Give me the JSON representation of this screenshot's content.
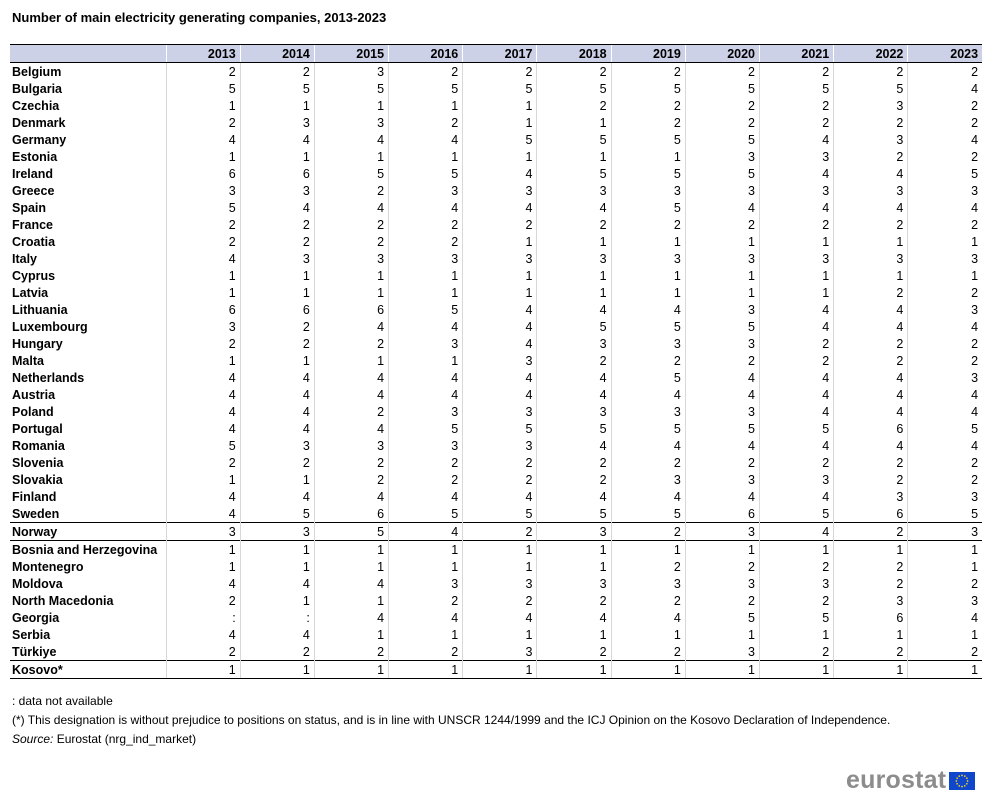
{
  "title": "Number of main electricity generating companies, 2013-2023",
  "chart_data": {
    "type": "table",
    "title": "Number of main electricity generating companies, 2013-2023",
    "columns": [
      "2013",
      "2014",
      "2015",
      "2016",
      "2017",
      "2018",
      "2019",
      "2020",
      "2021",
      "2022",
      "2023"
    ],
    "rows": [
      {
        "country": "Belgium",
        "values": [
          "2",
          "2",
          "3",
          "2",
          "2",
          "2",
          "2",
          "2",
          "2",
          "2",
          "2"
        ]
      },
      {
        "country": "Bulgaria",
        "values": [
          "5",
          "5",
          "5",
          "5",
          "5",
          "5",
          "5",
          "5",
          "5",
          "5",
          "4"
        ]
      },
      {
        "country": "Czechia",
        "values": [
          "1",
          "1",
          "1",
          "1",
          "1",
          "2",
          "2",
          "2",
          "2",
          "3",
          "2"
        ]
      },
      {
        "country": "Denmark",
        "values": [
          "2",
          "3",
          "3",
          "2",
          "1",
          "1",
          "2",
          "2",
          "2",
          "2",
          "2"
        ]
      },
      {
        "country": "Germany",
        "values": [
          "4",
          "4",
          "4",
          "4",
          "5",
          "5",
          "5",
          "5",
          "4",
          "3",
          "4"
        ]
      },
      {
        "country": "Estonia",
        "values": [
          "1",
          "1",
          "1",
          "1",
          "1",
          "1",
          "1",
          "3",
          "3",
          "2",
          "2"
        ]
      },
      {
        "country": "Ireland",
        "values": [
          "6",
          "6",
          "5",
          "5",
          "4",
          "5",
          "5",
          "5",
          "4",
          "4",
          "5"
        ]
      },
      {
        "country": "Greece",
        "values": [
          "3",
          "3",
          "2",
          "3",
          "3",
          "3",
          "3",
          "3",
          "3",
          "3",
          "3"
        ]
      },
      {
        "country": "Spain",
        "values": [
          "5",
          "4",
          "4",
          "4",
          "4",
          "4",
          "5",
          "4",
          "4",
          "4",
          "4"
        ]
      },
      {
        "country": "France",
        "values": [
          "2",
          "2",
          "2",
          "2",
          "2",
          "2",
          "2",
          "2",
          "2",
          "2",
          "2"
        ]
      },
      {
        "country": "Croatia",
        "values": [
          "2",
          "2",
          "2",
          "2",
          "1",
          "1",
          "1",
          "1",
          "1",
          "1",
          "1"
        ]
      },
      {
        "country": "Italy",
        "values": [
          "4",
          "3",
          "3",
          "3",
          "3",
          "3",
          "3",
          "3",
          "3",
          "3",
          "3"
        ]
      },
      {
        "country": "Cyprus",
        "values": [
          "1",
          "1",
          "1",
          "1",
          "1",
          "1",
          "1",
          "1",
          "1",
          "1",
          "1"
        ]
      },
      {
        "country": "Latvia",
        "values": [
          "1",
          "1",
          "1",
          "1",
          "1",
          "1",
          "1",
          "1",
          "1",
          "2",
          "2"
        ]
      },
      {
        "country": "Lithuania",
        "values": [
          "6",
          "6",
          "6",
          "5",
          "4",
          "4",
          "4",
          "3",
          "4",
          "4",
          "3"
        ]
      },
      {
        "country": "Luxembourg",
        "values": [
          "3",
          "2",
          "4",
          "4",
          "4",
          "5",
          "5",
          "5",
          "4",
          "4",
          "4"
        ]
      },
      {
        "country": "Hungary",
        "values": [
          "2",
          "2",
          "2",
          "3",
          "4",
          "3",
          "3",
          "3",
          "2",
          "2",
          "2"
        ]
      },
      {
        "country": "Malta",
        "values": [
          "1",
          "1",
          "1",
          "1",
          "3",
          "2",
          "2",
          "2",
          "2",
          "2",
          "2"
        ]
      },
      {
        "country": "Netherlands",
        "values": [
          "4",
          "4",
          "4",
          "4",
          "4",
          "4",
          "5",
          "4",
          "4",
          "4",
          "3"
        ]
      },
      {
        "country": "Austria",
        "values": [
          "4",
          "4",
          "4",
          "4",
          "4",
          "4",
          "4",
          "4",
          "4",
          "4",
          "4"
        ]
      },
      {
        "country": "Poland",
        "values": [
          "4",
          "4",
          "2",
          "3",
          "3",
          "3",
          "3",
          "3",
          "4",
          "4",
          "4"
        ]
      },
      {
        "country": "Portugal",
        "values": [
          "4",
          "4",
          "4",
          "5",
          "5",
          "5",
          "5",
          "5",
          "5",
          "6",
          "5"
        ]
      },
      {
        "country": "Romania",
        "values": [
          "5",
          "3",
          "3",
          "3",
          "3",
          "4",
          "4",
          "4",
          "4",
          "4",
          "4"
        ]
      },
      {
        "country": "Slovenia",
        "values": [
          "2",
          "2",
          "2",
          "2",
          "2",
          "2",
          "2",
          "2",
          "2",
          "2",
          "2"
        ]
      },
      {
        "country": "Slovakia",
        "values": [
          "1",
          "1",
          "2",
          "2",
          "2",
          "2",
          "3",
          "3",
          "3",
          "2",
          "2"
        ]
      },
      {
        "country": "Finland",
        "values": [
          "4",
          "4",
          "4",
          "4",
          "4",
          "4",
          "4",
          "4",
          "4",
          "3",
          "3"
        ]
      },
      {
        "country": "Sweden",
        "values": [
          "4",
          "5",
          "6",
          "5",
          "5",
          "5",
          "5",
          "6",
          "5",
          "6",
          "5"
        ]
      },
      {
        "country": "Norway",
        "values": [
          "3",
          "3",
          "5",
          "4",
          "2",
          "3",
          "2",
          "3",
          "4",
          "2",
          "3"
        ],
        "group_start": true
      },
      {
        "country": "Bosnia and Herzegovina",
        "values": [
          "1",
          "1",
          "1",
          "1",
          "1",
          "1",
          "1",
          "1",
          "1",
          "1",
          "1"
        ],
        "group_start": true
      },
      {
        "country": "Montenegro",
        "values": [
          "1",
          "1",
          "1",
          "1",
          "1",
          "1",
          "2",
          "2",
          "2",
          "2",
          "1"
        ]
      },
      {
        "country": "Moldova",
        "values": [
          "4",
          "4",
          "4",
          "3",
          "3",
          "3",
          "3",
          "3",
          "3",
          "2",
          "2"
        ]
      },
      {
        "country": "North Macedonia",
        "values": [
          "2",
          "1",
          "1",
          "2",
          "2",
          "2",
          "2",
          "2",
          "2",
          "3",
          "3"
        ]
      },
      {
        "country": "Georgia",
        "values": [
          ":",
          ":",
          "4",
          "4",
          "4",
          "4",
          "4",
          "5",
          "5",
          "6",
          "4"
        ]
      },
      {
        "country": "Serbia",
        "values": [
          "4",
          "4",
          "1",
          "1",
          "1",
          "1",
          "1",
          "1",
          "1",
          "1",
          "1"
        ]
      },
      {
        "country": "Türkiye",
        "values": [
          "2",
          "2",
          "2",
          "2",
          "3",
          "2",
          "2",
          "3",
          "2",
          "2",
          "2"
        ]
      },
      {
        "country": "Kosovo*",
        "values": [
          "1",
          "1",
          "1",
          "1",
          "1",
          "1",
          "1",
          "1",
          "1",
          "1",
          "1"
        ],
        "group_start": true
      }
    ]
  },
  "footnotes": {
    "not_available": ": data not available",
    "kosovo": "(*) This designation is without prejudice to positions on status, and is in line with UNSCR 1244/1999 and the ICJ Opinion on the Kosovo Declaration of Independence.",
    "source_label": "Source:",
    "source_text": "Eurostat (nrg_ind_market)"
  },
  "logo": {
    "text": "eurostat",
    "flag_icon": "eu-flag-icon",
    "flag_color": "#0e47cb",
    "star_color": "#ffd617"
  },
  "colors": {
    "header_bg": "#ccd1e7",
    "logo_gray": "#8c8c8c"
  }
}
